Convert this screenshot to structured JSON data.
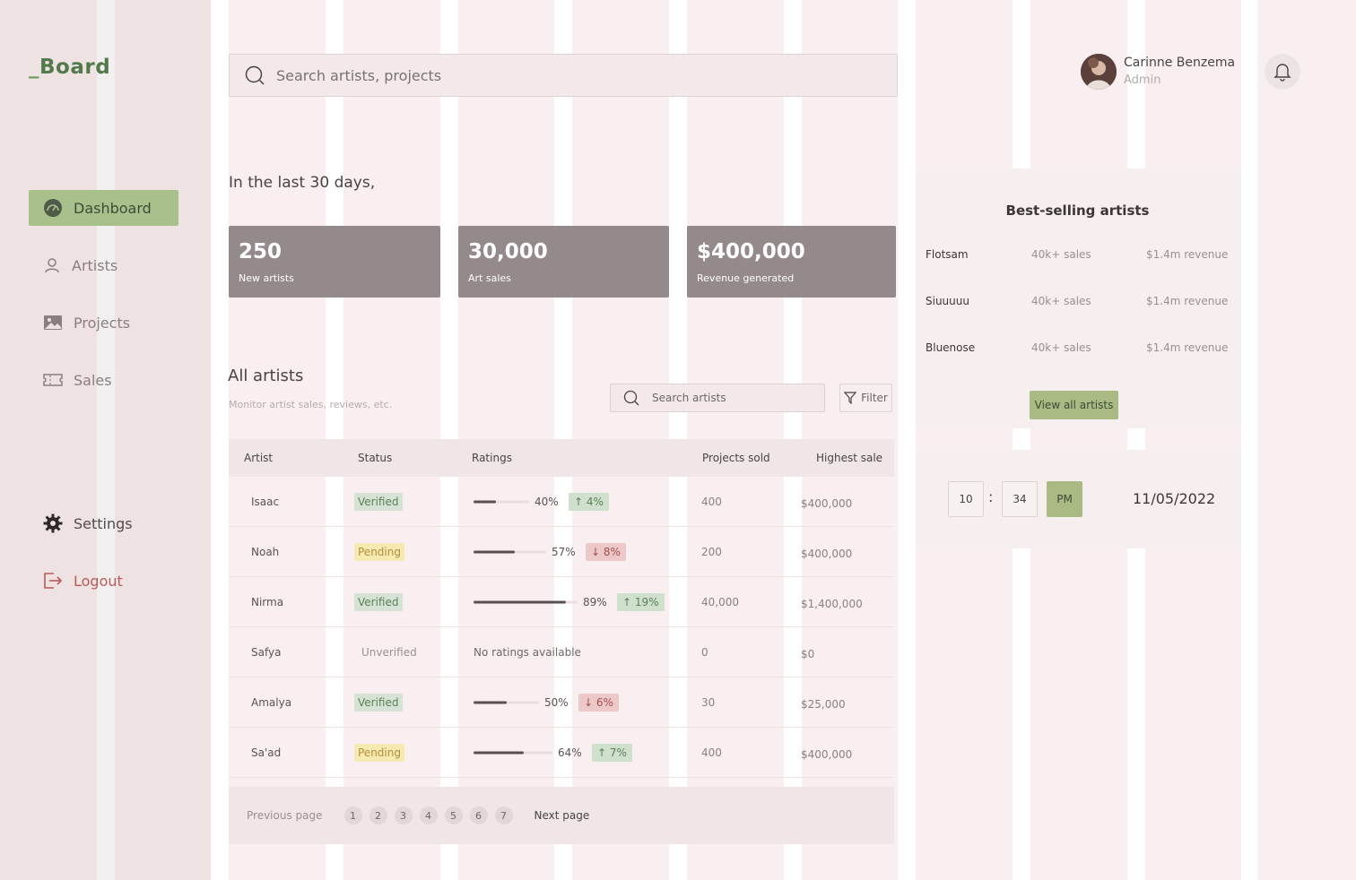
{
  "app": {
    "logo_prefix": "_",
    "logo_name": "Board"
  },
  "nav": {
    "items": [
      {
        "label": "Dashboard",
        "icon": "dashboard-icon",
        "active": true
      },
      {
        "label": "Artists",
        "icon": "user-icon"
      },
      {
        "label": "Projects",
        "icon": "image-icon"
      },
      {
        "label": "Sales",
        "icon": "ticket-icon"
      }
    ],
    "settings": "Settings",
    "logout": "Logout"
  },
  "search": {
    "placeholder": "Search artists, projects"
  },
  "user": {
    "name": "Carinne Benzema",
    "role": "Admin"
  },
  "summary": {
    "heading": "In the last 30 days,",
    "stats": [
      {
        "value": "250",
        "label": "New artists"
      },
      {
        "value": "30,000",
        "label": "Art sales"
      },
      {
        "value": "$400,000",
        "label": "Revenue generated"
      }
    ]
  },
  "artists": {
    "title": "All artists",
    "subtitle": "Monitor artist sales, reviews, etc.",
    "search_placeholder": "Search artists",
    "filter_label": "Filter",
    "columns": [
      "Artist",
      "Status",
      "Ratings",
      "Projects sold",
      "Highest sale"
    ],
    "rows": [
      {
        "name": "Isaac",
        "status": "Verified",
        "rating": "40%",
        "rating_value": 0.4,
        "change": "4%",
        "direction": "up",
        "projects": "400",
        "highest": "$400,000"
      },
      {
        "name": "Noah",
        "status": "Pending",
        "rating": "57%",
        "rating_value": 0.57,
        "change": "8%",
        "direction": "down",
        "projects": "200",
        "highest": "$400,000"
      },
      {
        "name": "Nirma",
        "status": "Verified",
        "rating": "89%",
        "rating_value": 0.89,
        "change": "19%",
        "direction": "up",
        "projects": "40,000",
        "highest": "$1,400,000"
      },
      {
        "name": "Safya",
        "status": "Unverified",
        "rating": "No ratings available",
        "rating_value": null,
        "change": "",
        "direction": "",
        "projects": "0",
        "highest": "$0"
      },
      {
        "name": "Amalya",
        "status": "Verified",
        "rating": "50%",
        "rating_value": 0.5,
        "change": "6%",
        "direction": "down",
        "projects": "30",
        "highest": "$25,000"
      },
      {
        "name": "Sa'ad",
        "status": "Pending",
        "rating": "64%",
        "rating_value": 0.64,
        "change": "7%",
        "direction": "up",
        "projects": "400",
        "highest": "$400,000"
      }
    ],
    "pagination": {
      "prev": "Previous page",
      "pages": [
        "1",
        "2",
        "3",
        "4",
        "5",
        "6",
        "7"
      ],
      "next": "Next page"
    }
  },
  "best_selling": {
    "title": "Best-selling artists",
    "rows": [
      {
        "name": "Flotsam",
        "sales": "40k+ sales",
        "revenue": "$1.4m revenue"
      },
      {
        "name": "Siuuuuu",
        "sales": "40k+ sales",
        "revenue": "$1.4m revenue"
      },
      {
        "name": "Bluenose",
        "sales": "40k+ sales",
        "revenue": "$1.4m revenue"
      }
    ],
    "button": "View all artists"
  },
  "clock": {
    "hour": "10",
    "separator": ":",
    "minute": "34",
    "ampm": "PM",
    "date": "11/05/2022"
  },
  "colors": {
    "accent": "#a9c08c",
    "stat_bg": "#958a8b",
    "up": "#5d7f5a",
    "down": "#a54d4d"
  }
}
